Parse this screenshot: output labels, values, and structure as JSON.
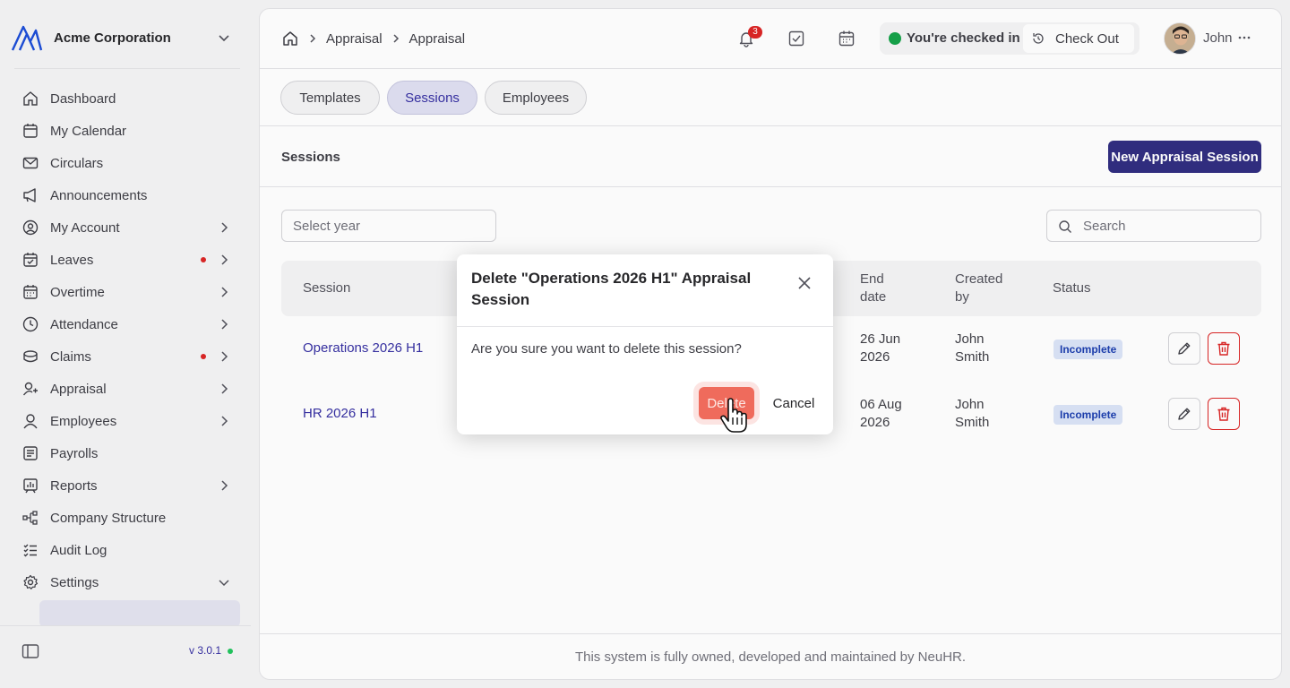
{
  "sidebar": {
    "company": "Acme Corporation",
    "items": [
      {
        "label": "Dashboard",
        "icon": "home-icon"
      },
      {
        "label": "My Calendar",
        "icon": "calendar-icon"
      },
      {
        "label": "Circulars",
        "icon": "mail-icon"
      },
      {
        "label": "Announcements",
        "icon": "megaphone-icon"
      },
      {
        "label": "My Account",
        "icon": "user-circle-icon"
      },
      {
        "label": "Leaves",
        "icon": "calendar-check-icon"
      },
      {
        "label": "Overtime",
        "icon": "calendar-clock-icon"
      },
      {
        "label": "Attendance",
        "icon": "clock-icon"
      },
      {
        "label": "Claims",
        "icon": "coins-icon"
      },
      {
        "label": "Appraisal",
        "icon": "user-star-icon"
      },
      {
        "label": "Employees",
        "icon": "user-icon"
      },
      {
        "label": "Payrolls",
        "icon": "receipt-icon"
      },
      {
        "label": "Reports",
        "icon": "chart-icon"
      },
      {
        "label": "Company Structure",
        "icon": "org-tree-icon"
      },
      {
        "label": "Audit Log",
        "icon": "checklist-icon"
      },
      {
        "label": "Settings",
        "icon": "gear-icon"
      }
    ],
    "version": "v 3.0.1",
    "status_color": "#22c55e"
  },
  "topbar": {
    "breadcrumbs": [
      "Appraisal",
      "Appraisal"
    ],
    "notification_count": "3",
    "checkin_status": "You're checked in",
    "checkout_label": "Check Out",
    "user_name": "John"
  },
  "tabs": [
    "Templates",
    "Sessions",
    "Employees"
  ],
  "active_tab": "Sessions",
  "section": {
    "title": "Sessions",
    "new_button": "New Appraisal Session"
  },
  "filters": {
    "year_placeholder": "Select year",
    "search_placeholder": "Search"
  },
  "table": {
    "headers": {
      "session": "Session",
      "end_date_1": "End",
      "end_date_2": "date",
      "created_1": "Created",
      "created_2": "by",
      "status": "Status"
    },
    "rows": [
      {
        "session": "Operations 2026 H1",
        "end_1": "26 Jun",
        "end_2": "2026",
        "by_1": "John",
        "by_2": "Smith",
        "status": "Incomplete"
      },
      {
        "session": "HR 2026 H1",
        "end_1": "06 Aug",
        "end_2": "2026",
        "by_1": "John",
        "by_2": "Smith",
        "status": "Incomplete"
      }
    ]
  },
  "footer": "This system is fully owned, developed and maintained by NeuHR.",
  "modal": {
    "title": "Delete \"Operations 2026 H1\" Appraisal Session",
    "body": "Are you sure you want to delete this session?",
    "delete_label": "Delete",
    "cancel_label": "Cancel"
  },
  "colors": {
    "accent": "#312e81",
    "danger": "#dc2626",
    "link": "#3730a3"
  }
}
